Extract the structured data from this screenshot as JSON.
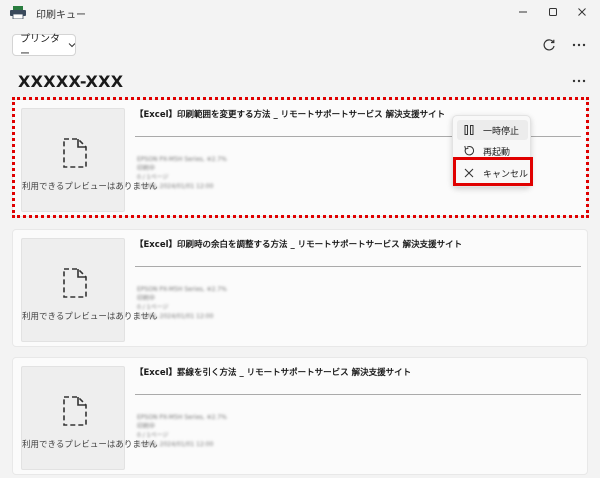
{
  "window": {
    "title": "印刷キュー",
    "icon": "printer-app-icon"
  },
  "toolbar": {
    "printer_label": "プリンター",
    "refresh_icon": "refresh-icon",
    "more_icon": "more-icon"
  },
  "queue": {
    "title": "XXXXX-XXX"
  },
  "jobs": [
    {
      "title": "【Excel】印刷範囲を変更する方法 _ リモートサポートサービス 解決支援サイト",
      "no_preview": "利用できるプレビューはありません",
      "details": [
        "EPSON PX-M5H Series, ※2.7%",
        "印刷中",
        "0 / 1ページ",
        "1.2MB, 2024/01/01 12:00"
      ]
    },
    {
      "title": "【Excel】印刷時の余白を調整する方法 _ リモートサポートサービス 解決支援サイト",
      "no_preview": "利用できるプレビューはありません",
      "details": [
        "EPSON PX-M5H Series, ※2.7%",
        "印刷中",
        "0 / 1ページ",
        "1.2MB, 2024/01/01 12:00"
      ]
    },
    {
      "title": "【Excel】罫線を引く方法 _ リモートサポートサービス 解決支援サイト",
      "no_preview": "利用できるプレビューはありません",
      "details": [
        "EPSON PX-M5H Series, ※2.7%",
        "印刷中",
        "0 / 1ページ",
        "1.2MB, 2024/01/01 12:00"
      ]
    }
  ],
  "context_menu": {
    "items": [
      {
        "label": "一時停止",
        "icon": "pause-icon"
      },
      {
        "label": "再起動",
        "icon": "restart-icon"
      },
      {
        "label": "キャンセル",
        "icon": "close-icon"
      }
    ]
  },
  "colors": {
    "highlight": "#e00000",
    "background": "#f3f3f3",
    "card": "#fbfbfb"
  }
}
